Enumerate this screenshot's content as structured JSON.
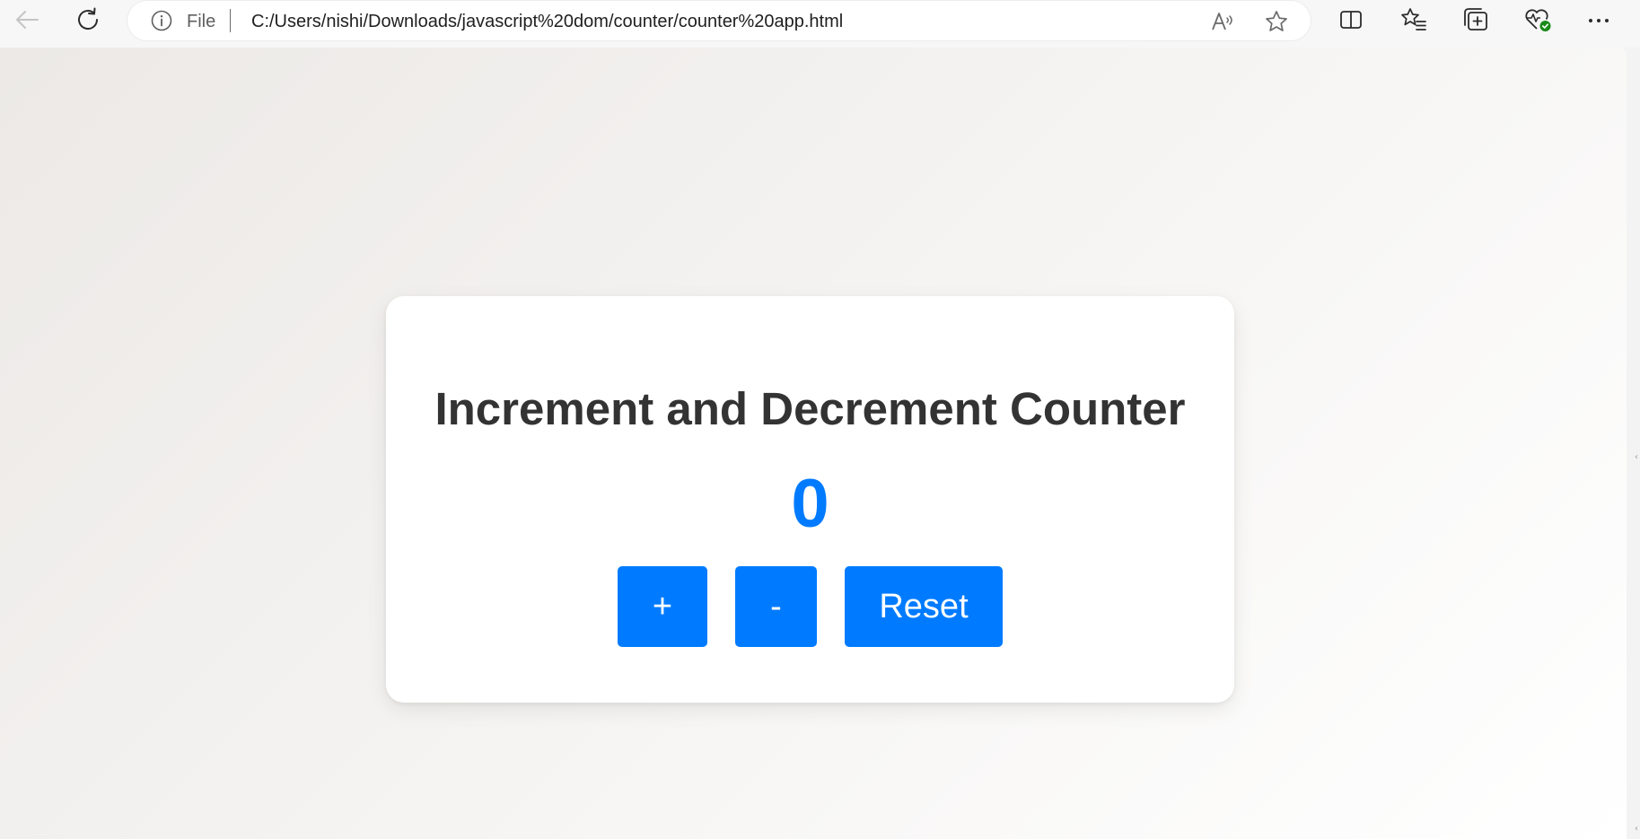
{
  "browser": {
    "address_bar": {
      "scheme_label": "File",
      "url": "C:/Users/nishi/Downloads/javascript%20dom/counter/counter%20app.html"
    },
    "icons": {
      "back": "arrow-left-icon",
      "refresh": "refresh-icon",
      "info": "info-icon",
      "read_aloud": "read-aloud-icon",
      "favorite": "star-icon",
      "split_screen": "split-screen-icon",
      "favorites_list": "favorites-icon",
      "collections": "collections-icon",
      "browser_essentials": "heart-pulse-icon",
      "menu": "more-icon"
    }
  },
  "page": {
    "title": "Increment and Decrement Counter",
    "counter_value": "0",
    "buttons": {
      "increment": "+",
      "decrement": "-",
      "reset": "Reset"
    }
  },
  "colors": {
    "accent": "#007bff",
    "title_text": "#333333",
    "card_bg": "#ffffff",
    "page_gradient_start": "#ece9e6",
    "page_gradient_end": "#ffffff"
  }
}
